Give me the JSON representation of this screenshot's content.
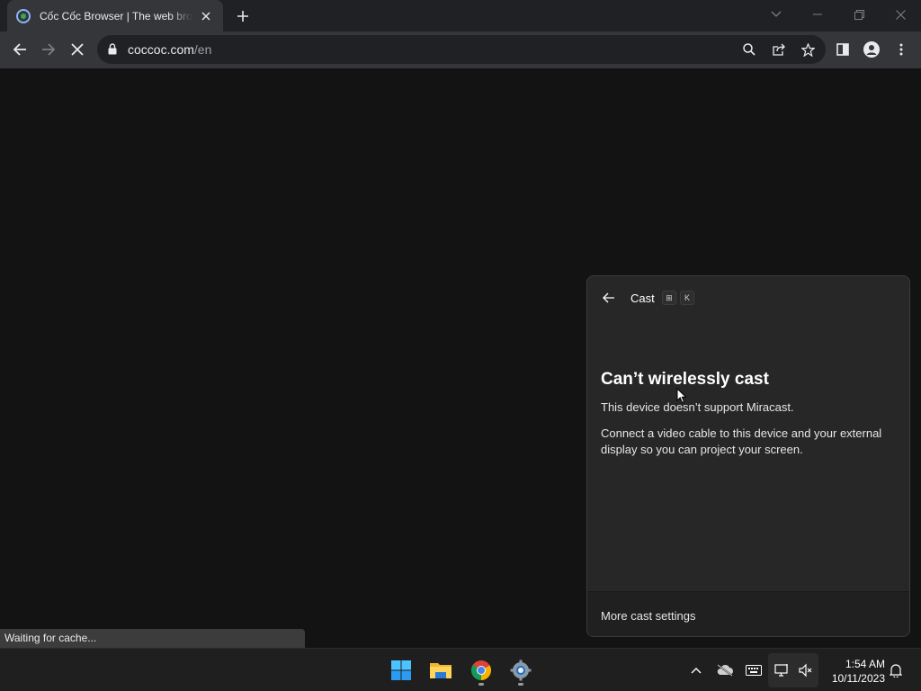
{
  "browser": {
    "tab": {
      "title": "Cốc Cốc Browser | The web browser for Vietnamese users"
    },
    "url": {
      "domain": "coccoc.com",
      "path": "/en"
    },
    "status_text": "Waiting for cache..."
  },
  "icons": {
    "tab": [
      "coccoc-favicon",
      "close-icon",
      "plus-icon"
    ],
    "window": [
      "chevron-down-icon",
      "minimize-icon",
      "restore-icon",
      "close-icon"
    ],
    "toolbar": [
      "back-arrow-icon",
      "forward-arrow-icon",
      "stop-icon",
      "lock-icon",
      "search-icon",
      "share-icon",
      "star-icon",
      "side-panel-icon",
      "profile-icon",
      "kebab-menu-icon"
    ],
    "taskbar": [
      "windows-start-icon",
      "file-explorer-icon",
      "chrome-icon",
      "settings-gear-icon"
    ],
    "tray": [
      "chevron-up-icon",
      "cloud-off-icon",
      "keyboard-icon",
      "network-icon",
      "volume-muted-icon",
      "bell-icon"
    ]
  },
  "cast_panel": {
    "title": "Cast",
    "shortcut_keys": [
      "⊞",
      "K"
    ],
    "heading": "Can’t wirelessly cast",
    "message": "This device doesn’t support Miracast.",
    "detail": "Connect a video cable to this device and your external display so you can project your screen.",
    "more_settings": "More cast settings"
  },
  "taskbar": {
    "time": "1:54 AM",
    "date": "10/11/2023"
  },
  "colors": {
    "tab_strip": "#202124",
    "toolbar": "#35363a",
    "page": "#131313",
    "flyout": "#272727",
    "taskbar": "#1f1f1f"
  }
}
